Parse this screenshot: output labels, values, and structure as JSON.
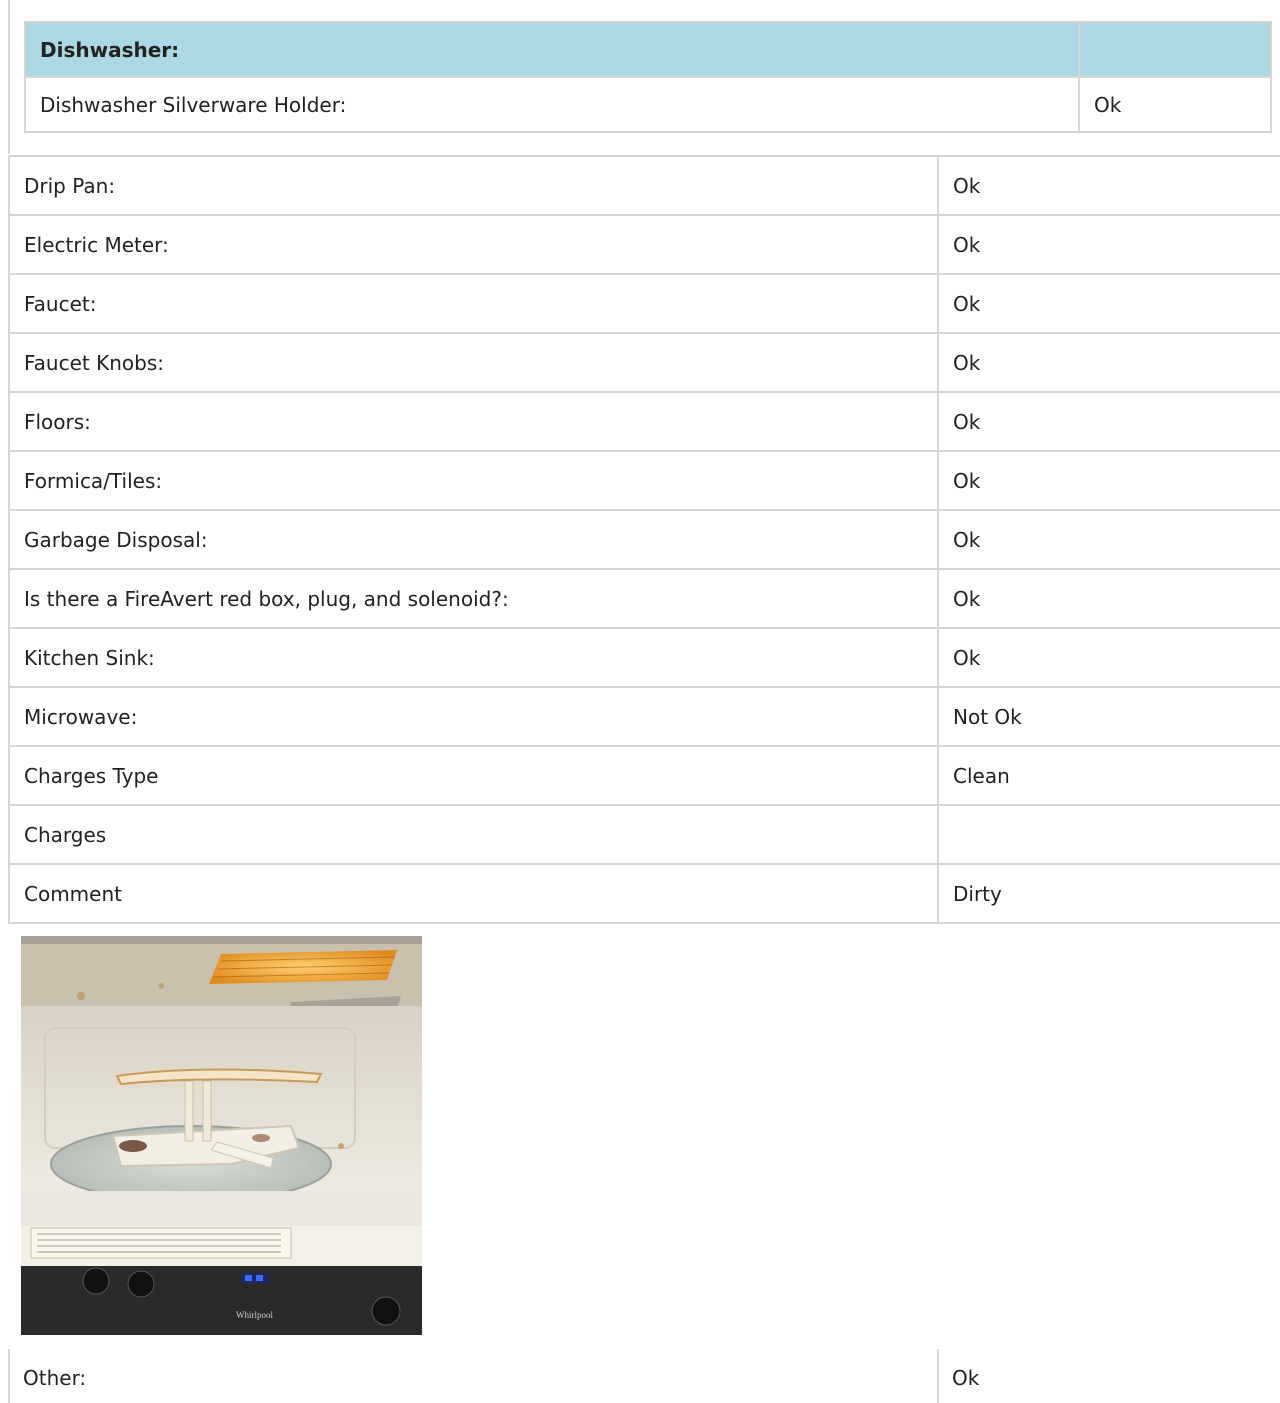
{
  "dishwasher_section": {
    "header": "Dishwasher:",
    "row": {
      "label": "Dishwasher Silverware Holder:",
      "value": "Ok"
    }
  },
  "items": [
    {
      "label": "Drip Pan:",
      "value": "Ok"
    },
    {
      "label": "Electric Meter:",
      "value": "Ok"
    },
    {
      "label": "Faucet:",
      "value": "Ok"
    },
    {
      "label": "Faucet Knobs:",
      "value": "Ok"
    },
    {
      "label": "Floors:",
      "value": "Ok"
    },
    {
      "label": "Formica/Tiles:",
      "value": "Ok"
    },
    {
      "label": "Garbage Disposal:",
      "value": "Ok"
    },
    {
      "label": "Is there a FireAvert red box, plug, and solenoid?:",
      "value": "Ok"
    },
    {
      "label": "Kitchen Sink:",
      "value": "Ok"
    },
    {
      "label": "Microwave:",
      "value": "Not Ok"
    },
    {
      "label": "Charges Type",
      "value": "Clean"
    },
    {
      "label": "Charges",
      "value": ""
    },
    {
      "label": "Comment",
      "value": "Dirty"
    }
  ],
  "photo": {
    "brand_text": "Whirlpool",
    "colors": {
      "interior": "#ece8df",
      "light": "#f0a020",
      "panel": "#2a2a2a"
    }
  },
  "bottom_row": {
    "label": "Other:",
    "value": "Ok"
  }
}
